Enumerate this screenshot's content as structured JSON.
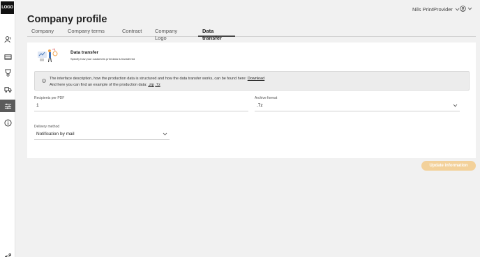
{
  "sidebar": {
    "logo_text": "LOGO",
    "items": [
      {
        "icon": "users-icon"
      },
      {
        "icon": "printer-icon"
      },
      {
        "icon": "badge-icon"
      },
      {
        "icon": "truck-icon"
      },
      {
        "icon": "sliders-icon",
        "active": true
      },
      {
        "icon": "info-icon"
      }
    ],
    "bottom_icon": "link-icon"
  },
  "header": {
    "user_name": "Nils PrintProvider",
    "account_icon": "account-icon"
  },
  "page_title": "Company profile",
  "tabs": [
    {
      "label": "Company"
    },
    {
      "label": "Company terms"
    },
    {
      "label": "Contract"
    },
    {
      "label": "Company Logo"
    },
    {
      "label": "Data transfer",
      "active": true
    }
  ],
  "card": {
    "title": "Data transfer",
    "subtitle": "Specify how your customers print data is transferred",
    "info": {
      "line1_text": "The interface description, how the production data is structured and how the data transfer works, can be found here:",
      "line1_link": "Download",
      "line2_text": "And here you can find an example of the production data:",
      "link_zip": ".zip",
      "link_7z": ".7z"
    },
    "recipients_label": "Recipients per PDF",
    "recipients_value": "1",
    "archive_label": "Archive format",
    "archive_value": ".7z",
    "delivery_label": "Delivery method",
    "delivery_value": "Notification by mail"
  },
  "update_button": "Update information",
  "colors": {
    "accent": "#f3d19a",
    "sidebar_active": "#5b5b5b",
    "logo_bg": "#111111"
  }
}
